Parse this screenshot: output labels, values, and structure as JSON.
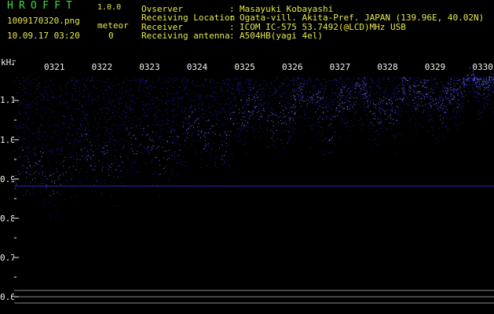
{
  "header": {
    "brand_title": "HROFFT",
    "brand_version": "1.0.0",
    "file_name": "1009170320.png",
    "datetime": "10.09.17 03:20",
    "meteor_label": "meteor",
    "meteor_count": "0"
  },
  "station_info": [
    {
      "key": "Ovserver",
      "sep": ":",
      "value": "Masayuki Kobayashi"
    },
    {
      "key": "Receiving Location",
      "sep": ":",
      "value": "Ogata-vill. Akita-Pref. JAPAN (139.96E, 40.02N)"
    },
    {
      "key": "Receiver",
      "sep": ":",
      "value": "ICOM IC-575 53.7492(@LCD)MHz USB"
    },
    {
      "key": "Receiving antenna",
      "sep": ":",
      "value": "A504HB(yagi 4el)"
    }
  ],
  "spectrogram": {
    "y_unit": "kHz",
    "y_ticks": [
      "1.1",
      "1.0",
      "0.9",
      "0.8",
      "0.7",
      "0.6"
    ],
    "x_ticks": [
      "0321",
      "0322",
      "0323",
      "0324",
      "0325",
      "0326",
      "0327",
      "0328",
      "0329",
      "0330"
    ],
    "colors": {
      "background": "#000000",
      "signal_dim": "#1a1a8c",
      "signal_bright": "#6a6aff",
      "tick_labels": "#f2f2f2",
      "header_green": "#3fdc3f",
      "header_yellow": "#e8e84a"
    }
  }
}
